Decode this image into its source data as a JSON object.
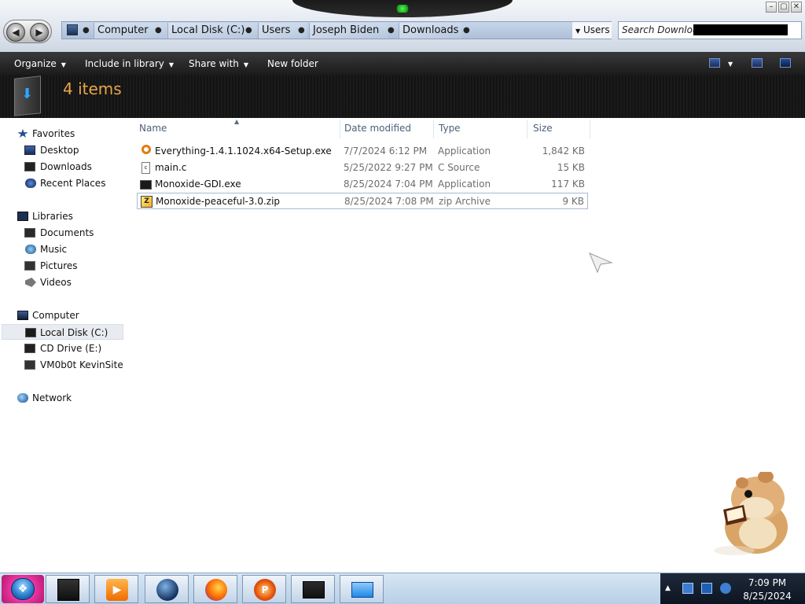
{
  "window": {
    "breadcrumbs": [
      "Computer",
      "Local Disk (C:)",
      "Users",
      "Joseph Biden",
      "Downloads"
    ],
    "address_dropdown": "Users",
    "search_placeholder": "Search Downloads"
  },
  "toolbar": {
    "organize": "Organize",
    "include_in_library": "Include in library",
    "share_with": "Share with",
    "new_folder": "New folder"
  },
  "header": {
    "items_count": "4 items"
  },
  "navigation": {
    "favorites": {
      "label": "Favorites",
      "items": [
        "Desktop",
        "Downloads",
        "Recent Places"
      ]
    },
    "libraries": {
      "label": "Libraries",
      "items": [
        "Documents",
        "Music",
        "Pictures",
        "Videos"
      ]
    },
    "computer": {
      "label": "Computer",
      "items": [
        "Local Disk (C:)",
        "CD Drive (E:)",
        "VM0b0t KevinSite"
      ],
      "selected": "Local Disk (C:)"
    },
    "network": {
      "label": "Network"
    }
  },
  "columns": {
    "name": "Name",
    "date_modified": "Date modified",
    "type": "Type",
    "size": "Size"
  },
  "files": [
    {
      "name": "Everything-1.4.1.1024.x64-Setup.exe",
      "date": "7/7/2024 6:12 PM",
      "type": "Application",
      "size": "1,842 KB",
      "icon": "magnifier-icon"
    },
    {
      "name": "main.c",
      "date": "5/25/2022 9:27 PM",
      "type": "C Source",
      "size": "15 KB",
      "icon": "c-source-file-icon"
    },
    {
      "name": "Monoxide-GDI.exe",
      "date": "8/25/2024 7:04 PM",
      "type": "Application",
      "size": "117 KB",
      "icon": "application-window-icon"
    },
    {
      "name": "Monoxide-peaceful-3.0.zip",
      "date": "8/25/2024 7:08 PM",
      "type": "zip Archive",
      "size": "9 KB",
      "icon": "zip-archive-icon"
    }
  ],
  "taskbar": {
    "clock_time": "7:09 PM",
    "clock_date": "8/25/2024",
    "apps": [
      "monitor-icon",
      "media-player-icon",
      "globe-icon",
      "firefox-icon",
      "paint-icon",
      "screen-icon",
      "keyboard-icon"
    ]
  }
}
